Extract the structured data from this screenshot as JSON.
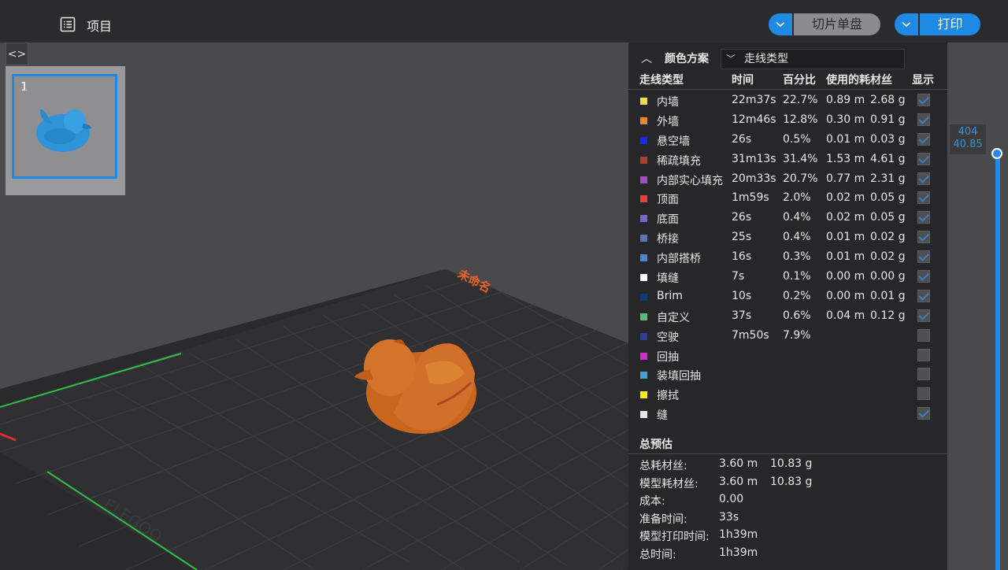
{
  "topbar": {
    "project_label": "项目",
    "slice_button": "切片单盘",
    "print_button": "打印"
  },
  "plate": {
    "index": "1",
    "bed_label": "未命名",
    "brand": "ELEGOO"
  },
  "panel": {
    "scheme_label": "颜色方案",
    "scheme_value": "走线类型",
    "headers": {
      "type": "走线类型",
      "time": "时间",
      "percent": "百分比",
      "filament": "使用的耗材丝",
      "show": "显示"
    },
    "rows": [
      {
        "name": "内墙",
        "color": "#f5d94a",
        "time": "22m37s",
        "percent": "22.7%",
        "length": "0.89 m",
        "weight": "2.68 g",
        "checked": true
      },
      {
        "name": "外墙",
        "color": "#f0842e",
        "time": "12m46s",
        "percent": "12.8%",
        "length": "0.30 m",
        "weight": "0.91 g",
        "checked": true
      },
      {
        "name": "悬空墙",
        "color": "#1b27f0",
        "time": "26s",
        "percent": "0.5%",
        "length": "0.01 m",
        "weight": "0.03 g",
        "checked": true
      },
      {
        "name": "稀疏填充",
        "color": "#b03c32",
        "time": "31m13s",
        "percent": "31.4%",
        "length": "1.53 m",
        "weight": "4.61 g",
        "checked": true
      },
      {
        "name": "内部实心填充",
        "color": "#a04ec4",
        "time": "20m33s",
        "percent": "20.7%",
        "length": "0.77 m",
        "weight": "2.31 g",
        "checked": true
      },
      {
        "name": "顶面",
        "color": "#e8403c",
        "time": "1m59s",
        "percent": "2.0%",
        "length": "0.02 m",
        "weight": "0.05 g",
        "checked": true
      },
      {
        "name": "底面",
        "color": "#7a62d0",
        "time": "26s",
        "percent": "0.4%",
        "length": "0.02 m",
        "weight": "0.05 g",
        "checked": true
      },
      {
        "name": "桥接",
        "color": "#5a74b8",
        "time": "25s",
        "percent": "0.4%",
        "length": "0.01 m",
        "weight": "0.02 g",
        "checked": true
      },
      {
        "name": "内部搭桥",
        "color": "#4f86c8",
        "time": "16s",
        "percent": "0.3%",
        "length": "0.01 m",
        "weight": "0.02 g",
        "checked": true
      },
      {
        "name": "填缝",
        "color": "#ffffff",
        "time": "7s",
        "percent": "0.1%",
        "length": "0.00 m",
        "weight": "0.00 g",
        "checked": true
      },
      {
        "name": "Brim",
        "color": "#0e3a78",
        "time": "10s",
        "percent": "0.2%",
        "length": "0.00 m",
        "weight": "0.01 g",
        "checked": true
      },
      {
        "name": "自定义",
        "color": "#4cc07a",
        "time": "37s",
        "percent": "0.6%",
        "length": "0.04 m",
        "weight": "0.12 g",
        "checked": true
      },
      {
        "name": "空驶",
        "color": "#2e3e9a",
        "time": "7m50s",
        "percent": "7.9%",
        "length": "",
        "weight": "",
        "checked": false
      },
      {
        "name": "回抽",
        "color": "#d22ad2",
        "time": "",
        "percent": "",
        "length": "",
        "weight": "",
        "checked": false
      },
      {
        "name": "装填回抽",
        "color": "#3fa4d0",
        "time": "",
        "percent": "",
        "length": "",
        "weight": "",
        "checked": false
      },
      {
        "name": "擦拭",
        "color": "#f5ee1c",
        "time": "",
        "percent": "",
        "length": "",
        "weight": "",
        "checked": false
      },
      {
        "name": "缝",
        "color": "#e6e6e6",
        "time": "",
        "percent": "",
        "length": "",
        "weight": "",
        "checked": true
      }
    ],
    "summary": {
      "title": "总预估",
      "items": [
        {
          "label": "总耗材丝:",
          "v1": "3.60 m",
          "v2": "10.83 g"
        },
        {
          "label": "模型耗材丝:",
          "v1": "3.60 m",
          "v2": "10.83 g"
        },
        {
          "label": "成本:",
          "v1": "0.00",
          "v2": ""
        },
        {
          "label": "准备时间:",
          "v1": "33s",
          "v2": ""
        },
        {
          "label": "模型打印时间:",
          "v1": "1h39m",
          "v2": ""
        },
        {
          "label": "总时间:",
          "v1": "1h39m",
          "v2": ""
        }
      ]
    }
  },
  "slider": {
    "layer": "404",
    "height": "40.85"
  },
  "colors": {
    "accent": "#1f8ae6",
    "model": "#d2702a",
    "thumbnail_model": "#2f93d8"
  }
}
